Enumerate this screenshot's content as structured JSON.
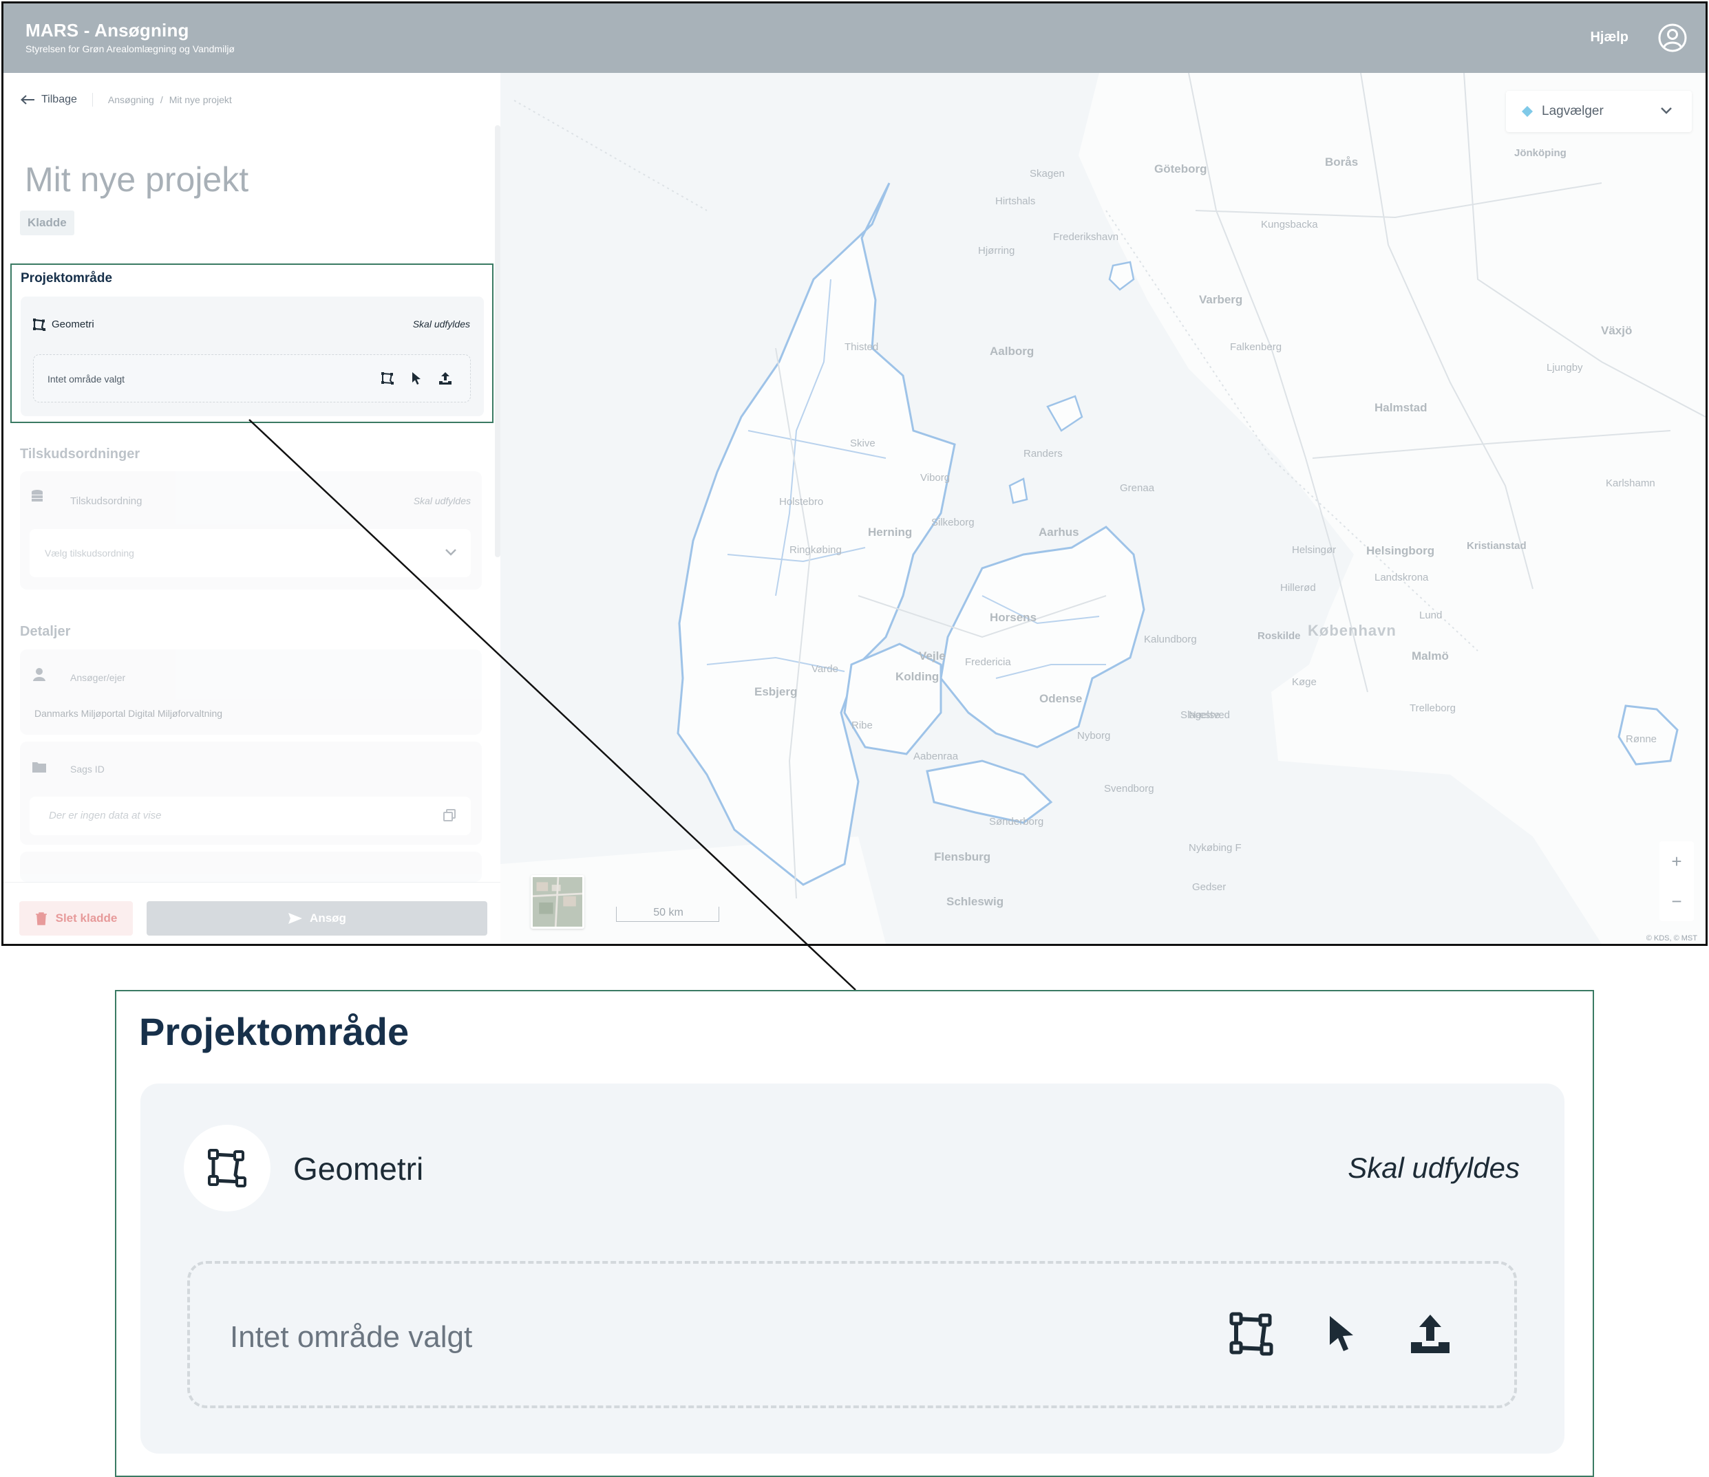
{
  "header": {
    "app_title": "MARS - Ansøgning",
    "app_subtitle": "Styrelsen for Grøn Arealomlægning og Vandmiljø",
    "help_label": "Hjælp",
    "user_icon": "user-circle-icon"
  },
  "breadcrumb": {
    "back_label": "Tilbage",
    "items": [
      "Ansøgning",
      "Mit nye projekt"
    ],
    "separator": "/"
  },
  "project": {
    "title": "Mit nye projekt",
    "status": "Kladde"
  },
  "sections": {
    "projektomraade": {
      "title": "Projektområde",
      "geometry_label": "Geometri",
      "geometry_required": "Skal udfyldes",
      "empty_text": "Intet område valgt",
      "tools": [
        "draw-polygon-icon",
        "select-pointer-icon",
        "upload-icon"
      ]
    },
    "tilskud": {
      "title": "Tilskudsordninger",
      "label": "Tilskudsordning",
      "required": "Skal udfyldes",
      "select_placeholder": "Vælg tilskudsordning"
    },
    "detaljer": {
      "title": "Detaljer",
      "applicant_label": "Ansøger/ejer",
      "applicant_value": "Danmarks Miljøportal Digital Miljøforvaltning",
      "case_label": "Sags ID",
      "case_empty": "Der er ingen data at vise"
    }
  },
  "footer": {
    "delete_label": "Slet kladde",
    "apply_label": "Ansøg"
  },
  "map": {
    "layer_picker_label": "Lagvælger",
    "zoom_in": "+",
    "zoom_out": "−",
    "scale_label": "50 km",
    "attribution": "© KDS, © MST",
    "places": [
      "Göteborg",
      "Borås",
      "Jönköping",
      "Kungsbacka",
      "Varberg",
      "Falkenberg",
      "Halmstad",
      "Växjö",
      "Ljungby",
      "Helsingborg",
      "Landskrona",
      "Lund",
      "Malmö",
      "Trelleborg",
      "Kristianstad",
      "Karlshamn",
      "Skagen",
      "Hirtshals",
      "Frederikshavn",
      "Hjørring",
      "Aalborg",
      "Randers",
      "Aarhus",
      "Silkeborg",
      "Herning",
      "Horsens",
      "Vejle",
      "Fredericia",
      "Kolding",
      "Odense",
      "Esbjerg",
      "København",
      "Roskilde",
      "Køge",
      "Slagelse",
      "Nyborg",
      "Svendborg",
      "Flensburg",
      "Schleswig",
      "Grenaa",
      "Holstebro",
      "Ringkøbing",
      "Skive",
      "Viborg",
      "Thisted",
      "Varde",
      "Ribe",
      "Aabenraa",
      "Sønderborg",
      "Nykøbing F",
      "Hillerød",
      "Helsingør",
      "Kalundborg",
      "Næstved",
      "Gedser",
      "Rønne"
    ]
  }
}
